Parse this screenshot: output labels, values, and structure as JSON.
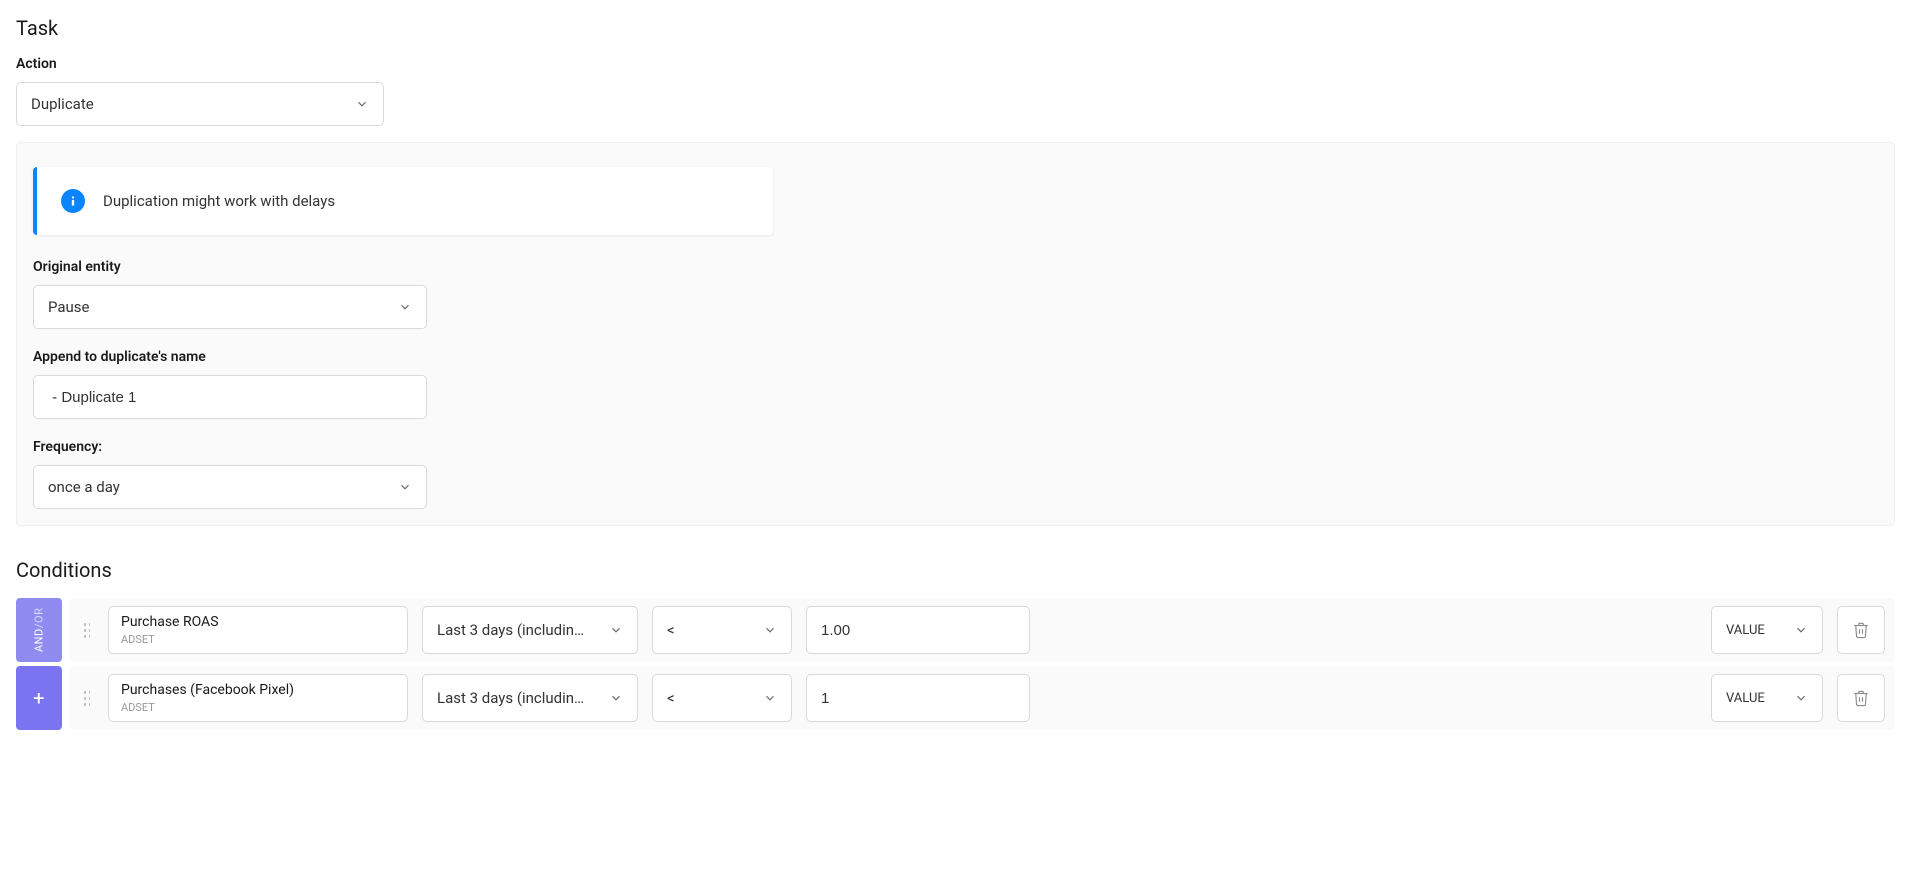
{
  "task": {
    "title": "Task",
    "action_label": "Action",
    "action_value": "Duplicate",
    "info_message": "Duplication might work with delays",
    "original_entity_label": "Original entity",
    "original_entity_value": "Pause",
    "append_label": "Append to duplicate's name",
    "append_value": " - Duplicate 1",
    "frequency_label": "Frequency:",
    "frequency_value": "once a day"
  },
  "conditions": {
    "title": "Conditions",
    "andor": {
      "and": "AND",
      "or": "OR",
      "plus": "+"
    },
    "rows": [
      {
        "metric": "Purchase ROAS",
        "level": "ADSET",
        "timeframe": "Last 3 days (includin…",
        "operator": "<",
        "value": "1.00",
        "value_type": "VALUE"
      },
      {
        "metric": "Purchases (Facebook Pixel)",
        "level": "ADSET",
        "timeframe": "Last 3 days (includin…",
        "operator": "<",
        "value": "1",
        "value_type": "VALUE"
      }
    ]
  }
}
